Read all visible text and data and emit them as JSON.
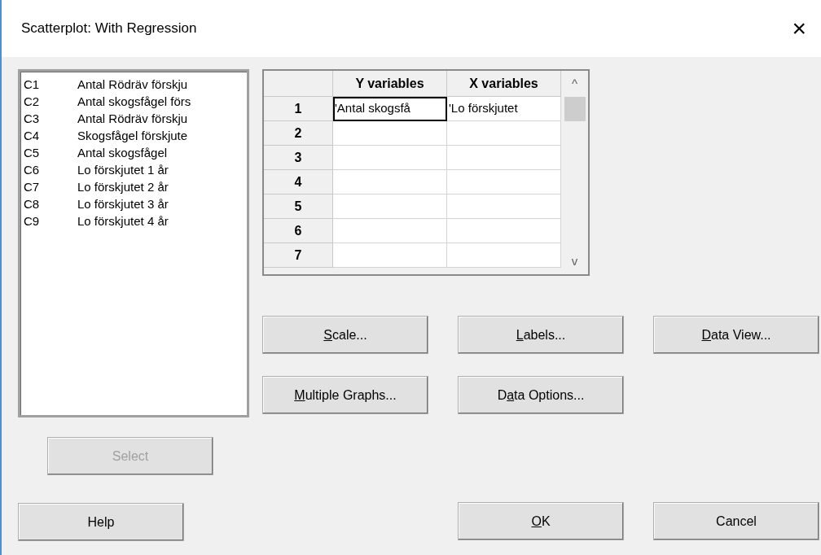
{
  "window": {
    "title": "Scatterplot: With Regression",
    "close": "×"
  },
  "variables": [
    {
      "code": "C1",
      "name": "Antal Rödräv förskju"
    },
    {
      "code": "C2",
      "name": "Antal skogsfågel förs"
    },
    {
      "code": "C3",
      "name": "Antal Rödräv förskju"
    },
    {
      "code": "C4",
      "name": "Skogsfågel förskjute"
    },
    {
      "code": "C5",
      "name": "Antal skogsfågel"
    },
    {
      "code": "C6",
      "name": "Lo förskjutet 1 år"
    },
    {
      "code": "C7",
      "name": "Lo förskjutet 2 år"
    },
    {
      "code": "C8",
      "name": "Lo förskjutet 3 år"
    },
    {
      "code": "C9",
      "name": "Lo förskjutet 4 år"
    }
  ],
  "grid": {
    "columns": [
      "Y variables",
      "X variables"
    ],
    "scroll_up": "^",
    "scroll_down": "v",
    "rows": [
      {
        "number": "1",
        "cells": [
          {
            "text": "'Antal skogsfå",
            "focused": true
          },
          {
            "text": "'Lo förskjutet",
            "focused": false
          }
        ]
      },
      {
        "number": "2",
        "cells": [
          {
            "focused": false
          },
          {
            "focused": false
          }
        ]
      },
      {
        "number": "3",
        "cells": [
          {
            "focused": false
          },
          {
            "focused": false
          }
        ]
      },
      {
        "number": "4",
        "cells": [
          {
            "focused": false
          },
          {
            "focused": false
          }
        ]
      },
      {
        "number": "5",
        "cells": [
          {
            "focused": false
          },
          {
            "focused": false
          }
        ]
      },
      {
        "number": "6",
        "cells": [
          {
            "focused": false
          },
          {
            "focused": false
          }
        ]
      },
      {
        "number": "7",
        "cells": [
          {
            "focused": false
          },
          {
            "focused": false
          }
        ]
      }
    ]
  },
  "option_buttons": [
    {
      "key": "S",
      "after": "cale..."
    },
    {
      "key": "L",
      "after": "abels..."
    },
    {
      "key": "D",
      "after": "ata View..."
    },
    {
      "key": "M",
      "after": "ultiple Graphs..."
    },
    {
      "before": "D",
      "key": "a",
      "after": "ta Options..."
    }
  ],
  "select_button": {
    "label": "Select",
    "disabled": true
  },
  "help_button": {
    "label": "Help"
  },
  "ok_button": {
    "key": "O",
    "after": "K"
  },
  "cancel_button": {
    "label": "Cancel"
  }
}
